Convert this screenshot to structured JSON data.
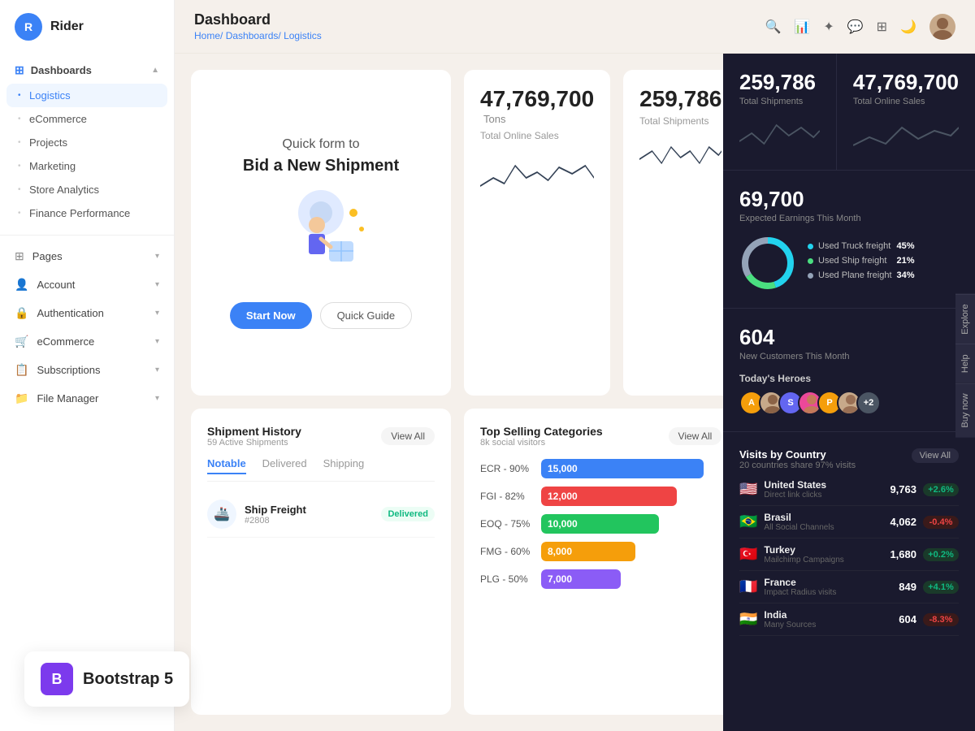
{
  "app": {
    "logo_letter": "R",
    "logo_name": "Rider"
  },
  "sidebar": {
    "dashboards_label": "Dashboards",
    "items": [
      {
        "id": "logistics",
        "label": "Logistics",
        "active": true
      },
      {
        "id": "ecommerce",
        "label": "eCommerce",
        "active": false
      },
      {
        "id": "projects",
        "label": "Projects",
        "active": false
      },
      {
        "id": "marketing",
        "label": "Marketing",
        "active": false
      },
      {
        "id": "store-analytics",
        "label": "Store Analytics",
        "active": false
      },
      {
        "id": "finance-performance",
        "label": "Finance Performance",
        "active": false
      }
    ],
    "main_items": [
      {
        "id": "pages",
        "label": "Pages",
        "icon": "⊞"
      },
      {
        "id": "account",
        "label": "Account",
        "icon": "👤"
      },
      {
        "id": "authentication",
        "label": "Authentication",
        "icon": "🔒"
      },
      {
        "id": "ecommerce2",
        "label": "eCommerce",
        "icon": "🛒"
      },
      {
        "id": "subscriptions",
        "label": "Subscriptions",
        "icon": "📋"
      },
      {
        "id": "file-manager",
        "label": "File Manager",
        "icon": "📁"
      }
    ]
  },
  "header": {
    "page_title": "Dashboard",
    "breadcrumb_home": "Home/",
    "breadcrumb_dashboards": "Dashboards/",
    "breadcrumb_current": "Logistics"
  },
  "hero": {
    "title": "Quick form to",
    "subtitle": "Bid a New Shipment",
    "btn_primary": "Start Now",
    "btn_secondary": "Quick Guide"
  },
  "stats": {
    "total_sales": "47,769,700",
    "total_sales_unit": "Tons",
    "total_sales_label": "Total Online Sales",
    "total_shipments": "259,786",
    "total_shipments_label": "Total Shipments",
    "expected_earnings": "69,700",
    "expected_earnings_label": "Expected Earnings This Month",
    "new_customers": "604",
    "new_customers_label": "New Customers This Month"
  },
  "freight": {
    "truck_label": "Used Truck freight",
    "truck_pct": "45%",
    "truck_val": 45,
    "ship_label": "Used Ship freight",
    "ship_pct": "21%",
    "ship_val": 21,
    "plane_label": "Used Plane freight",
    "plane_pct": "34%",
    "plane_val": 34
  },
  "heroes": {
    "title": "Today's Heroes",
    "avatars": [
      {
        "letter": "A",
        "color": "#f59e0b"
      },
      {
        "letter": "S",
        "color": "#6366f1"
      },
      {
        "letter": "P",
        "color": "#ec4899"
      },
      {
        "letter": "+2",
        "color": "#4b5563"
      }
    ]
  },
  "shipment_history": {
    "title": "Shipment History",
    "subtitle": "59 Active Shipments",
    "view_all": "View All",
    "tabs": [
      "Notable",
      "Delivered",
      "Shipping"
    ],
    "active_tab": "Notable",
    "items": [
      {
        "name": "Ship Freight",
        "id": "2808",
        "status": "Delivered"
      }
    ]
  },
  "top_selling": {
    "title": "Top Selling Categories",
    "subtitle": "8k social visitors",
    "view_all": "View All",
    "categories": [
      {
        "label": "ECR - 90%",
        "value": 15000,
        "display": "15,000",
        "color": "#3b82f6",
        "width": 90
      },
      {
        "label": "FGI - 82%",
        "value": 12000,
        "display": "12,000",
        "color": "#ef4444",
        "width": 75
      },
      {
        "label": "EOQ - 75%",
        "value": 10000,
        "display": "10,000",
        "color": "#22c55e",
        "width": 65
      },
      {
        "label": "FMG - 60%",
        "value": 8000,
        "display": "8,000",
        "color": "#f59e0b",
        "width": 52
      },
      {
        "label": "PLG - 50%",
        "value": 7000,
        "display": "7,000",
        "color": "#8b5cf6",
        "width": 44
      }
    ]
  },
  "visits": {
    "title": "Visits by Country",
    "subtitle": "20 countries share 97% visits",
    "view_all": "View All",
    "countries": [
      {
        "flag": "🇺🇸",
        "name": "United States",
        "source": "Direct link clicks",
        "visits": "9,763",
        "change": "+2.6%",
        "up": true
      },
      {
        "flag": "🇧🇷",
        "name": "Brasil",
        "source": "All Social Channels",
        "visits": "4,062",
        "change": "-0.4%",
        "up": false
      },
      {
        "flag": "🇹🇷",
        "name": "Turkey",
        "source": "Mailchimp Campaigns",
        "visits": "1,680",
        "change": "+0.2%",
        "up": true
      },
      {
        "flag": "🇫🇷",
        "name": "France",
        "source": "Impact Radius visits",
        "visits": "849",
        "change": "+4.1%",
        "up": true
      },
      {
        "flag": "🇮🇳",
        "name": "India",
        "source": "Many Sources",
        "visits": "604",
        "change": "-8.3%",
        "up": false
      }
    ]
  },
  "bootstrap_badge": {
    "letter": "B",
    "text": "Bootstrap 5"
  },
  "side_tabs": [
    "Explore",
    "Help",
    "Buy now"
  ]
}
